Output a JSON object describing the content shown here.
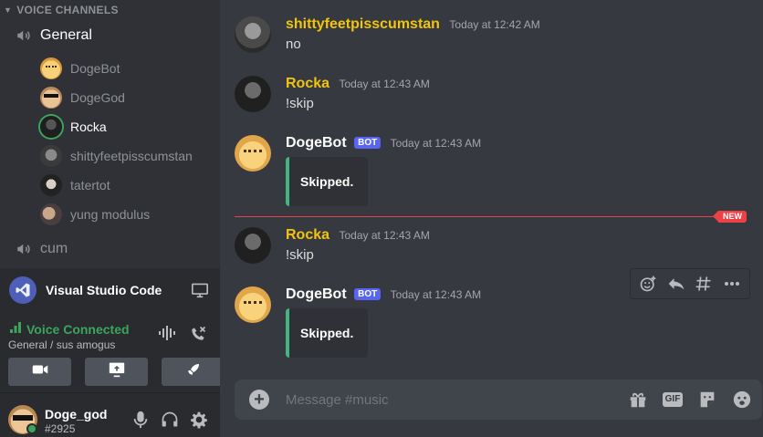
{
  "sidebar": {
    "voice_header": "VOICE CHANNELS",
    "channels": [
      {
        "name": "General"
      },
      {
        "name": "cum"
      }
    ],
    "members": [
      {
        "name": "DogeBot"
      },
      {
        "name": "DogeGod"
      },
      {
        "name": "Rocka"
      },
      {
        "name": "shittyfeetpisscumstan"
      },
      {
        "name": "tatertot"
      },
      {
        "name": "yung modulus"
      }
    ],
    "activity": {
      "name": "Visual Studio Code"
    },
    "voice": {
      "status": "Voice Connected",
      "location": "General / sus amogus"
    },
    "user": {
      "name": "Doge_god",
      "tag": "#2925"
    }
  },
  "chat": {
    "messages": [
      {
        "author": "shittyfeetpisscumstan",
        "timestamp": "Today at 12:42 AM",
        "text": "no"
      },
      {
        "author": "Rocka",
        "timestamp": "Today at 12:43 AM",
        "text": "!skip"
      },
      {
        "author": "DogeBot",
        "bot_tag": "BOT",
        "timestamp": "Today at 12:43 AM",
        "embed": "Skipped."
      },
      {
        "author": "Rocka",
        "timestamp": "Today at 12:43 AM",
        "text": "!skip"
      },
      {
        "author": "DogeBot",
        "bot_tag": "BOT",
        "timestamp": "Today at 12:43 AM",
        "embed": "Skipped."
      }
    ],
    "new_divider": "NEW",
    "composer": {
      "placeholder": "Message #music",
      "gif_label": "GIF"
    }
  },
  "colors": {
    "accent_green": "#3ba55d",
    "author_gold": "#f1c40f",
    "new_red": "#ed4245",
    "bot_blurple": "#5865f2"
  }
}
